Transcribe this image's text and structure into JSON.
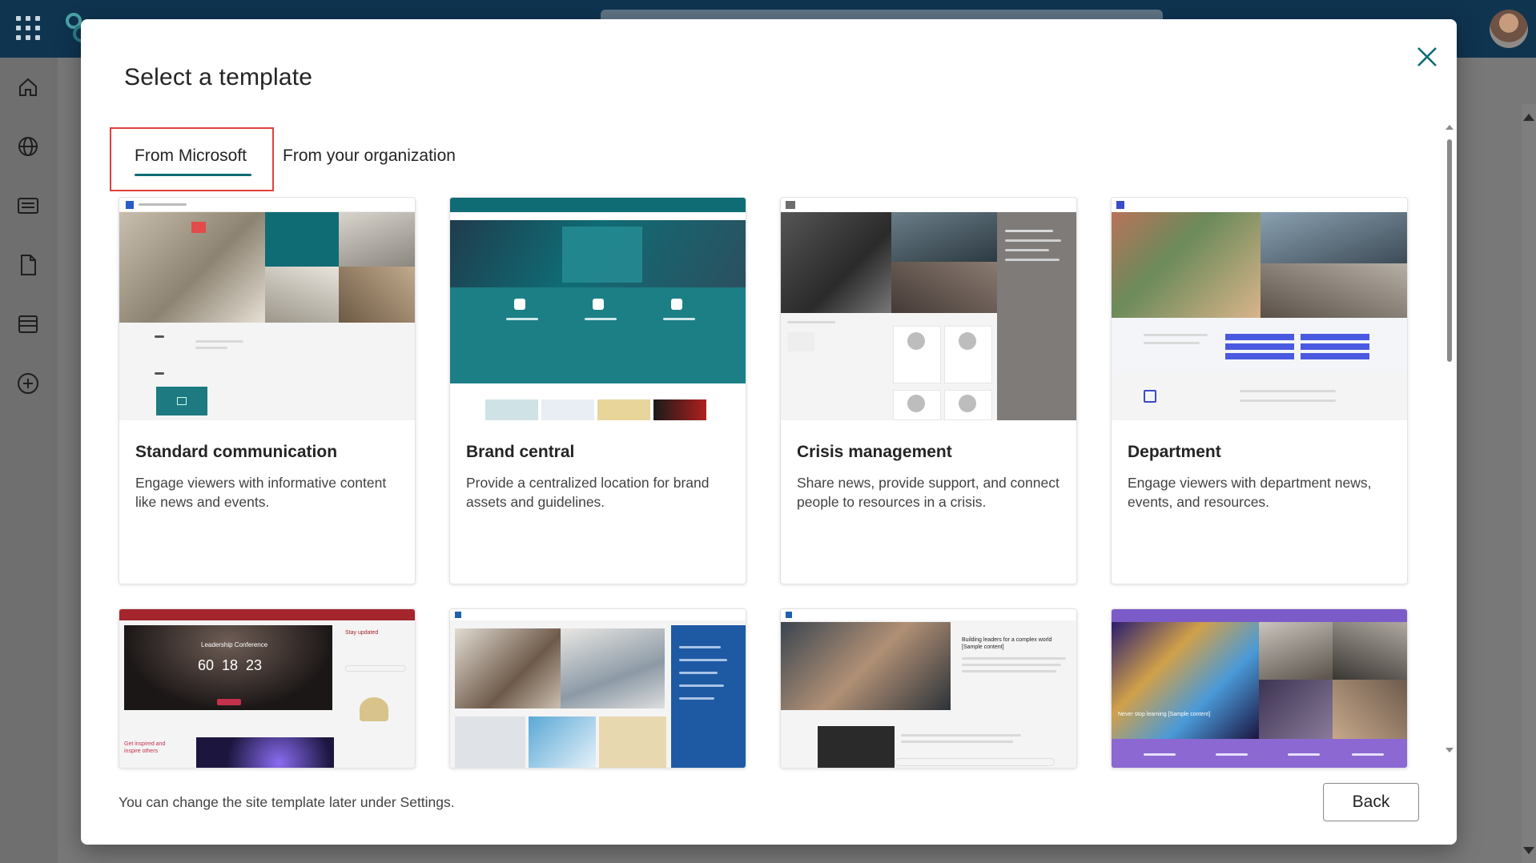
{
  "background": {
    "nav_icons": [
      "home-icon",
      "globe-icon",
      "news-icon",
      "document-icon",
      "list-icon",
      "add-icon"
    ]
  },
  "dialog": {
    "title": "Select a template",
    "close_icon": "close-icon",
    "tabs": [
      {
        "label": "From Microsoft",
        "selected": true
      },
      {
        "label": "From your organization",
        "selected": false
      }
    ],
    "templates": [
      {
        "name": "Standard communication",
        "description": "Engage viewers with informative content like news and events."
      },
      {
        "name": "Brand central",
        "description": "Provide a centralized location for brand assets and guidelines."
      },
      {
        "name": "Crisis management",
        "description": "Share news, provide support, and connect people to resources in a crisis."
      },
      {
        "name": "Department",
        "description": "Engage viewers with department news, events, and resources."
      }
    ],
    "preview_texts": {
      "event_countdown": [
        "60",
        "18",
        "23"
      ],
      "event_conference": "Leadership Conference",
      "event_inspired": "Get inspired and inspire others",
      "event_stay": "Stay updated",
      "learning_tagline": "Never stop learning [Sample content]",
      "leadership_heading": "Building leaders for a complex world [Sample content]"
    },
    "footer_note": "You can change the site template later under Settings.",
    "back_label": "Back"
  },
  "colors": {
    "accent": "#0f6c75",
    "highlight": "#e0413f",
    "topbar": "#0f3450"
  }
}
